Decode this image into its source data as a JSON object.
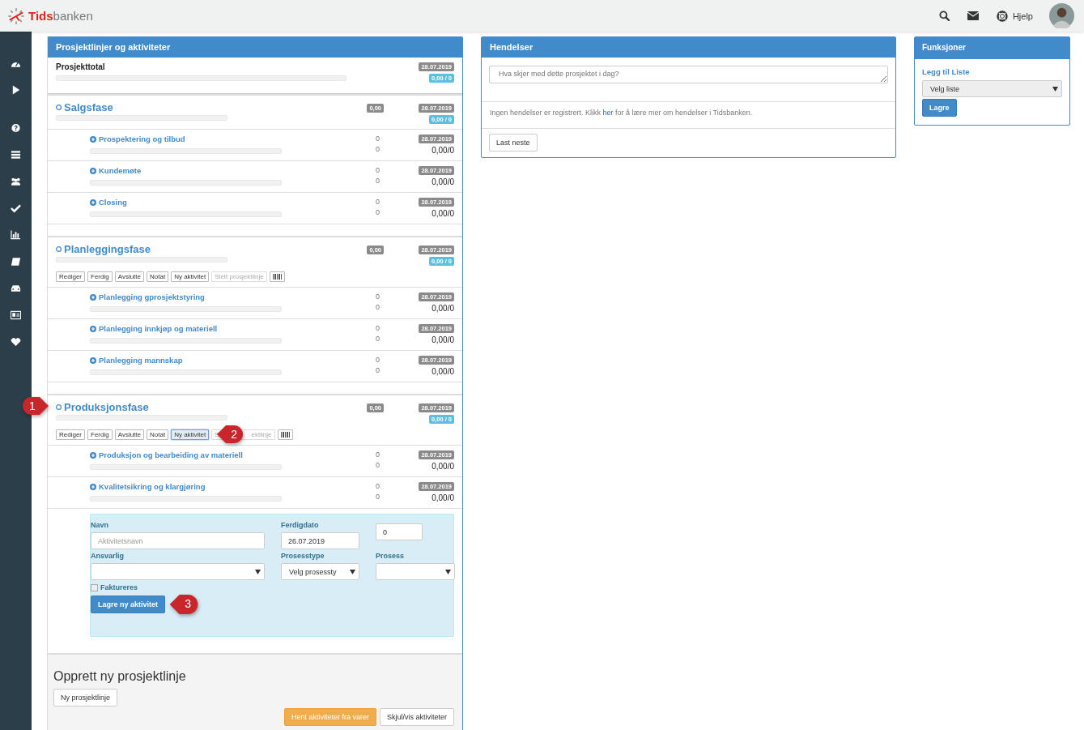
{
  "header": {
    "brand_first": "Tids",
    "brand_rest": "banken",
    "help": "Hjelp"
  },
  "project_panel": {
    "title": "Prosjektlinjer og aktiviteter",
    "total": {
      "label": "Prosjekttotal",
      "date": "28.07.2019",
      "sum": "0,00 / 0",
      "level": 0
    },
    "phases": [
      {
        "name": "Salgsfase",
        "level": 0,
        "amount": "0,00",
        "date": "28.07.2019",
        "sum": "0,00 / 0",
        "activities": [
          {
            "name": "Prospektering og tilbud",
            "level": 0,
            "count_1": "0",
            "count_2": "0",
            "date": "28.07.2019",
            "sum": "0,00/0"
          },
          {
            "name": "Kundemøte",
            "level": 0,
            "count_1": "0",
            "count_2": "0",
            "date": "28.07.2019",
            "sum": "0,00/0"
          },
          {
            "name": "Closing",
            "level": 0,
            "count_1": "0",
            "count_2": "0",
            "date": "28.07.2019",
            "sum": "0,00/0"
          }
        ]
      },
      {
        "name": "Planleggingsfase",
        "level": 0,
        "amount": "0,00",
        "date": "28.07.2019",
        "sum": "0,00 / 0",
        "actions": [
          {
            "kind": "text",
            "label": "Rediger",
            "selected": false,
            "disabled": false
          },
          {
            "kind": "text",
            "label": "Ferdig",
            "selected": false,
            "disabled": false
          },
          {
            "kind": "text",
            "label": "Avslutte",
            "selected": false,
            "disabled": false
          },
          {
            "kind": "text",
            "label": "Notat",
            "selected": false,
            "disabled": false
          },
          {
            "kind": "text",
            "label": "Ny aktivitet",
            "selected": false,
            "disabled": false
          },
          {
            "kind": "text",
            "label": "Slett prosjektlinje",
            "selected": false,
            "disabled": true
          },
          {
            "kind": "barcode",
            "selected": false,
            "disabled": false
          }
        ],
        "activities": [
          {
            "name": "Planlegging gprosjektstyring",
            "level": 0,
            "count_1": "0",
            "count_2": "0",
            "date": "28.07.2019",
            "sum": "0,00/0"
          },
          {
            "name": "Planlegging innkjøp og materiell",
            "level": 0,
            "count_1": "0",
            "count_2": "0",
            "date": "28.07.2019",
            "sum": "0,00/0"
          },
          {
            "name": "Planlegging mannskap",
            "level": 0,
            "count_1": "0",
            "count_2": "0",
            "date": "28.07.2019",
            "sum": "0,00/0"
          }
        ]
      },
      {
        "name": "Produksjonsfase",
        "level": 0,
        "callout": "1",
        "amount": "0,00",
        "date": "28.07.2019",
        "sum": "0,00 / 0",
        "actions": [
          {
            "kind": "text",
            "label": "Rediger",
            "selected": false,
            "disabled": false
          },
          {
            "kind": "text",
            "label": "Ferdig",
            "selected": false,
            "disabled": false
          },
          {
            "kind": "text",
            "label": "Avslutte",
            "selected": false,
            "disabled": false
          },
          {
            "kind": "text",
            "label": "Notat",
            "selected": false,
            "disabled": false
          },
          {
            "kind": "text",
            "label": "Ny aktivitet",
            "selected": true,
            "disabled": false,
            "callout": "2"
          },
          {
            "kind": "text",
            "label": "S",
            "label_end": "ektlinje",
            "selected": false,
            "disabled": true
          },
          {
            "kind": "barcode",
            "selected": false,
            "disabled": false
          }
        ],
        "activities": [
          {
            "name": "Produksjon og bearbeiding av materiell",
            "level": 0,
            "count_1": "0",
            "count_2": "0",
            "date": "28.07.2019",
            "sum": "0,00/0"
          },
          {
            "name": "Kvalitetsikring og klargjøring",
            "level": 0,
            "count_1": "0",
            "count_2": "0",
            "date": "28.07.2019",
            "sum": "0,00/0"
          }
        ],
        "form": {
          "name_label": "Navn",
          "name_placeholder": "Aktivitetsnavn",
          "date_label": "Ferdigdato",
          "date_value": "26.07.2019",
          "number_value": "0",
          "responsible_label": "Ansvarlig",
          "process_type_label": "Prosesstype",
          "process_type_value": "Velg prosessty",
          "process_label": "Prosess",
          "invoice_label": "Faktureres",
          "invoice_checked": false,
          "save_button": "Lagre ny aktivitet",
          "save_callout": "3"
        }
      }
    ],
    "create": {
      "title": "Opprett ny prosjektlinje",
      "new_button": "Ny prosjektlinje",
      "fetch_button": "Hent aktiviteter fra varer",
      "toggle_button": "Skjul/vis aktiviteter"
    }
  },
  "events_panel": {
    "title": "Hendelser",
    "placeholder": "Hva skjer med dette prosjektet i dag?",
    "message_before": "Ingen hendelser er registrert. Klikk ",
    "message_link": "her",
    "message_after": " for å lære mer om hendelser i Tidsbanken.",
    "more_button": "Last neste"
  },
  "functions_panel": {
    "title": "Funksjoner",
    "link": "Legg til Liste",
    "select": "Velg liste",
    "save_button": "Lagre"
  }
}
